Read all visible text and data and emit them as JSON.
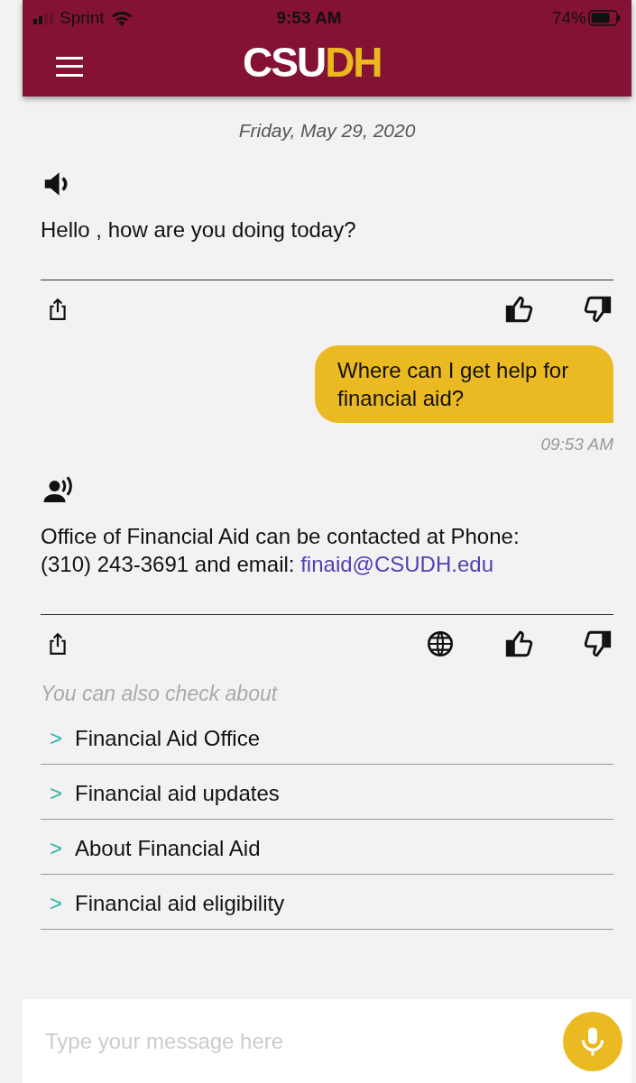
{
  "status_bar": {
    "carrier": "Sprint",
    "time": "9:53 AM",
    "battery": "74%"
  },
  "header": {
    "logo": [
      {
        "text": "CSU",
        "color": "#ffffff"
      },
      {
        "text": "DH",
        "color": "#eab81f"
      }
    ]
  },
  "date": "Friday, May 29, 2020",
  "messages": [
    {
      "kind": "bot",
      "text": "Hello , how are you doing today?",
      "actions": [
        {
          "kind": "share"
        },
        {
          "kind": "like"
        },
        {
          "kind": "dislike"
        }
      ]
    },
    {
      "kind": "user",
      "text": "Where can I get help for financial aid?",
      "time": "09:53 AM"
    },
    {
      "kind": "bot",
      "text": "Office of Financial Aid can be contacted at Phone: (310) 243-3691 and email: ",
      "link": "finaid@CSUDH.edu",
      "actions": [
        {
          "kind": "share"
        },
        {
          "kind": "globe"
        },
        {
          "kind": "like"
        },
        {
          "kind": "dislike"
        }
      ]
    }
  ],
  "suggestions": {
    "title": "You can also check about",
    "items": [
      {
        "arrow": ">",
        "label": "Financial Aid Office"
      },
      {
        "arrow": ">",
        "label": "Financial aid updates"
      },
      {
        "arrow": ">",
        "label": "About Financial Aid"
      },
      {
        "arrow": ">",
        "label": "Financial aid eligibility"
      }
    ]
  },
  "composer": {
    "placeholder": "Type your message here"
  }
}
